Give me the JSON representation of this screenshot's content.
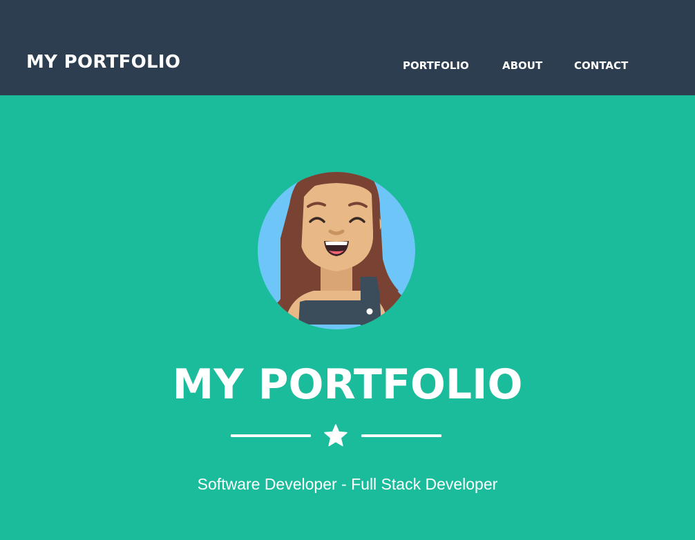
{
  "navbar": {
    "brand": "MY PORTFOLIO",
    "links": [
      {
        "label": "PORTFOLIO"
      },
      {
        "label": "ABOUT"
      },
      {
        "label": "CONTACT"
      }
    ]
  },
  "hero": {
    "avatar_icon": "smiling-woman-avatar-icon",
    "title": "MY PORTFOLIO",
    "divider_icon": "star-icon",
    "subtitle": "Software Developer - Full Stack Developer"
  },
  "colors": {
    "navbar_bg": "#2c3e50",
    "hero_bg": "#1abc9c",
    "text": "#ffffff",
    "avatar_bg": "#6ec6f8",
    "hair": "#7a4232",
    "skin": "#e8b887",
    "overalls": "#3b4d5b"
  }
}
